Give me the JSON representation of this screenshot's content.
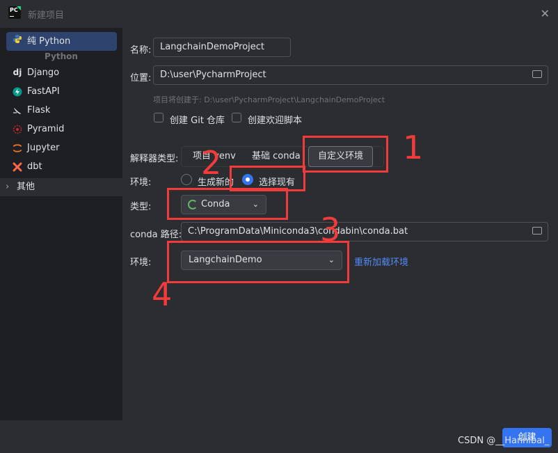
{
  "window": {
    "title": "新建项目"
  },
  "sidebar": {
    "selected": {
      "label": "纯 Python"
    },
    "section_label": "Python",
    "items": [
      {
        "label": "Django"
      },
      {
        "label": "FastAPI"
      },
      {
        "label": "Flask"
      },
      {
        "label": "Pyramid"
      },
      {
        "label": "Jupyter"
      },
      {
        "label": "dbt"
      }
    ],
    "other": {
      "label": "其他"
    }
  },
  "form": {
    "name": {
      "label": "名称:",
      "value": "LangchainDemoProject"
    },
    "location": {
      "label": "位置:",
      "value": "D:\\user\\PycharmProject"
    },
    "hint": "项目将创建于: D:\\user\\PycharmProject\\LangchainDemoProject",
    "checkbox_git": {
      "label": "创建 Git 仓库",
      "checked": false
    },
    "checkbox_welcome": {
      "label": "创建欢迎脚本",
      "checked": false
    },
    "interpreter_type": {
      "label": "解释器类型:",
      "options": [
        "项目 venv",
        "基础 conda",
        "自定义环境"
      ],
      "selected": "自定义环境"
    },
    "env_mode": {
      "label": "环境:",
      "options": [
        "生成新的",
        "选择现有"
      ],
      "selected": "选择现有"
    },
    "type": {
      "label": "类型:",
      "value": "Conda"
    },
    "conda_path": {
      "label": "conda 路径:",
      "value": "C:\\ProgramData\\Miniconda3\\condabin\\conda.bat"
    },
    "environment": {
      "label": "环境:",
      "value": "LangchainDemo",
      "reload_label": "重新加载环境"
    }
  },
  "annotations": {
    "numbers": [
      "1",
      "2",
      "3",
      "4"
    ],
    "color": "#F23B3B"
  },
  "footer": {
    "create_label": "创建",
    "watermark": "CSDN @__Hannibal_"
  },
  "colors": {
    "accent": "#3574F0",
    "background": "#2B2D30",
    "sidebar": "#1E1F22",
    "selected": "#2E436E",
    "link": "#548AF7"
  }
}
